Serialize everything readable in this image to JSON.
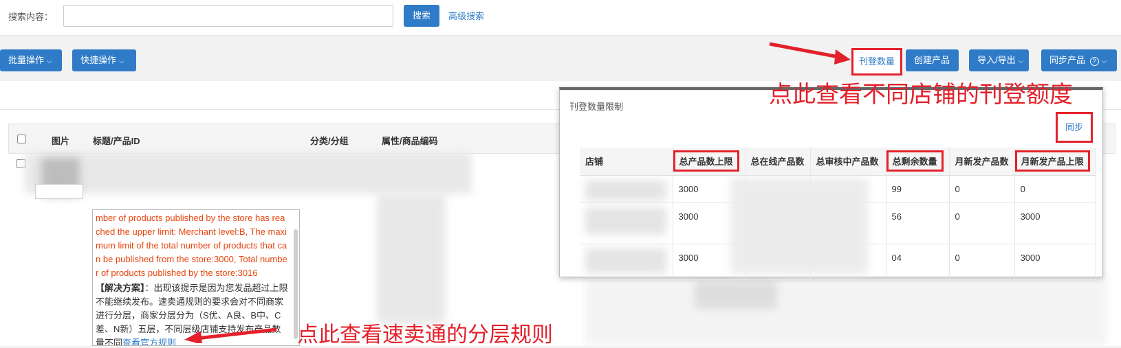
{
  "search": {
    "label": "搜索内容：",
    "placeholder": "",
    "button": "搜索",
    "advanced": "高级搜索"
  },
  "toolbar": {
    "bulk_ops": "批量操作",
    "quick_ops": "快捷操作",
    "listing_count": "刊登数量",
    "create_product": "创建产品",
    "import_export": "导入/导出",
    "sync_products": "同步产品"
  },
  "table": {
    "headers": [
      "图片",
      "标题/产品ID",
      "分类/分组",
      "属性/商品编码"
    ]
  },
  "error": {
    "text": "mber of products published by the store has reached the upper limit: Merchant level:B, The maximum limit of the total number of products that can be published from the store:3000, Total number of products published by the store:3016",
    "solution_label": "【解决方案】",
    "solution_text": "：出现该提示是因为您发品超过上限不能继续发布。速卖通规则的要求会对不同商家进行分层，商家分层分为（S优、A良、B中、C差、N新）五层，不同层级店铺支持发布产品数量不同",
    "solution_link": "查看官方规则"
  },
  "annotations": {
    "top": "点此查看不同店铺的刊登额度",
    "bottom": "点此查看速卖通的分层规则"
  },
  "popup": {
    "title": "刊登数量限制",
    "sync": "同步",
    "headers": [
      "店铺",
      "总产品数上限",
      "总在线产品数",
      "总审核中产品数",
      "总剩余数量",
      "月新发产品数",
      "月新发产品上限"
    ],
    "rows": [
      {
        "max_total": "3000",
        "remaining": "99",
        "monthly_new": "0",
        "monthly_limit": "0"
      },
      {
        "max_total": "3000",
        "remaining": "56",
        "monthly_new": "0",
        "monthly_limit": "3000"
      },
      {
        "max_total": "3000",
        "remaining": "04",
        "monthly_new": "0",
        "monthly_limit": "3000"
      }
    ]
  },
  "colors": {
    "primary": "#2f7bc8",
    "annotation_red": "#e3212b",
    "error_text": "#e8440e"
  }
}
